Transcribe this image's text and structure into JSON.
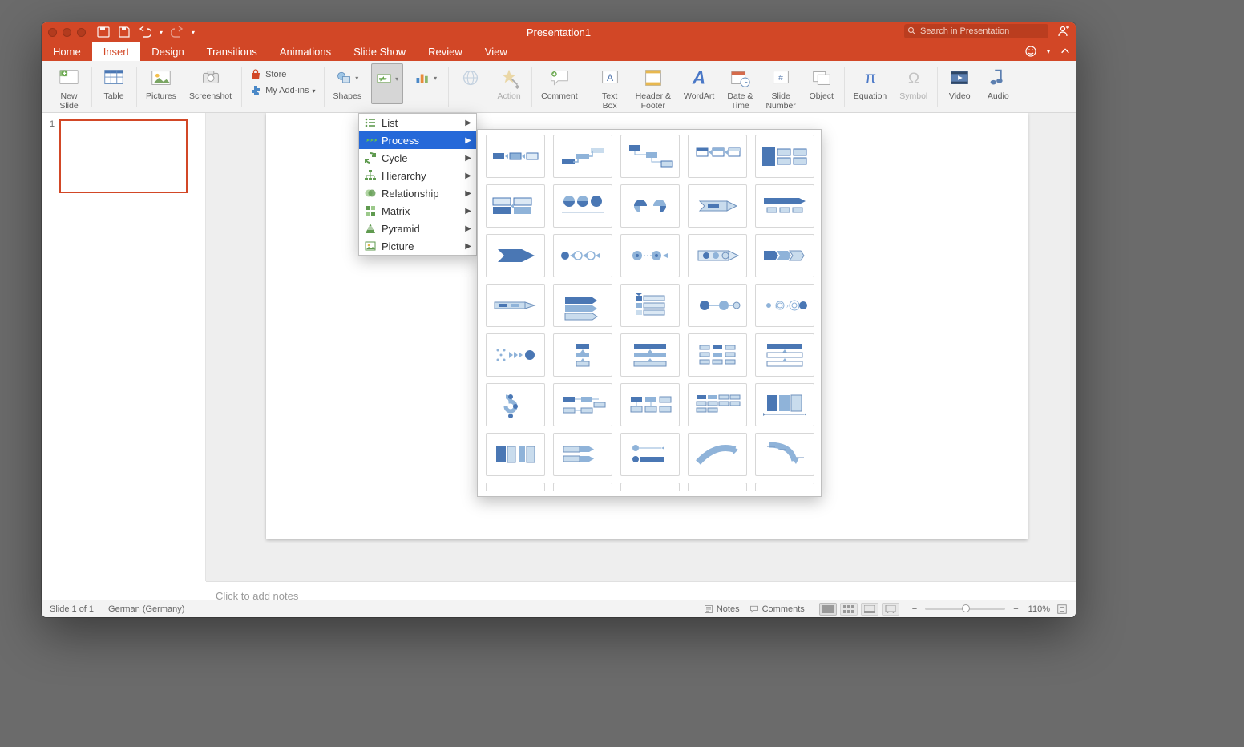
{
  "window": {
    "title": "Presentation1"
  },
  "search": {
    "placeholder": "Search in Presentation"
  },
  "tabs": {
    "items": [
      "Home",
      "Insert",
      "Design",
      "Transitions",
      "Animations",
      "Slide Show",
      "Review",
      "View"
    ],
    "active": "Insert"
  },
  "ribbon": {
    "new_slide": "New\nSlide",
    "table": "Table",
    "pictures": "Pictures",
    "screenshot": "Screenshot",
    "store": "Store",
    "my_addins": "My Add-ins",
    "shapes": "Shapes",
    "smartart_tooltip": "SmartArt",
    "chart": "Chart",
    "action": "Action",
    "comment": "Comment",
    "text_box": "Text\nBox",
    "header_footer": "Header &\nFooter",
    "wordart": "WordArt",
    "date_time": "Date &\nTime",
    "slide_number": "Slide\nNumber",
    "object": "Object",
    "equation": "Equation",
    "symbol": "Symbol",
    "video": "Video",
    "audio": "Audio"
  },
  "smartart_menu": {
    "items": [
      "List",
      "Process",
      "Cycle",
      "Hierarchy",
      "Relationship",
      "Matrix",
      "Pyramid",
      "Picture"
    ],
    "selected": "Process"
  },
  "notes_placeholder": "Click to add notes",
  "status": {
    "slide_info": "Slide 1 of 1",
    "language": "German (Germany)",
    "notes": "Notes",
    "comments": "Comments",
    "zoom": "110%"
  },
  "thumb": {
    "number": "1"
  }
}
